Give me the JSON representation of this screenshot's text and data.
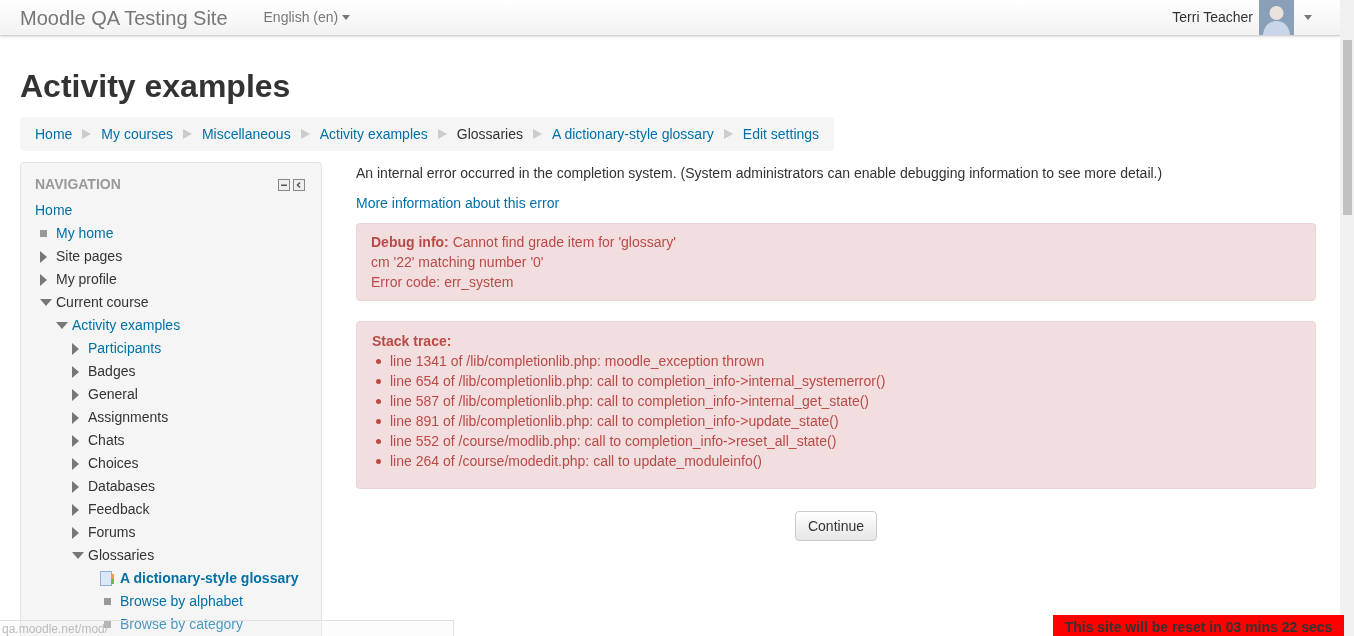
{
  "navbar": {
    "site_name": "Moodle QA Testing Site",
    "language": "English (en)",
    "user_name": "Terri Teacher"
  },
  "page_title": "Activity examples",
  "breadcrumb": [
    {
      "label": "Home",
      "link": true
    },
    {
      "label": "My courses",
      "link": true
    },
    {
      "label": "Miscellaneous",
      "link": true
    },
    {
      "label": "Activity examples",
      "link": true
    },
    {
      "label": "Glossaries",
      "link": false
    },
    {
      "label": "A dictionary-style glossary",
      "link": true
    },
    {
      "label": "Edit settings",
      "link": true
    }
  ],
  "navigation": {
    "title": "NAVIGATION",
    "items": [
      {
        "label": "Home",
        "kind": "root",
        "link": true,
        "current": false
      },
      {
        "label": "My home",
        "kind": "leaf",
        "link": true,
        "current": false
      },
      {
        "label": "Site pages",
        "kind": "branch",
        "expanded": false,
        "link": false,
        "current": false
      },
      {
        "label": "My profile",
        "kind": "branch",
        "expanded": false,
        "link": false,
        "current": false
      },
      {
        "label": "Current course",
        "kind": "branch",
        "expanded": true,
        "link": false,
        "current": false,
        "children": [
          {
            "label": "Activity examples",
            "kind": "branch",
            "expanded": true,
            "link": true,
            "current": false,
            "children": [
              {
                "label": "Participants",
                "kind": "branch",
                "expanded": false,
                "link": true,
                "current": false
              },
              {
                "label": "Badges",
                "kind": "branch",
                "expanded": false,
                "link": false,
                "current": false
              },
              {
                "label": "General",
                "kind": "branch",
                "expanded": false,
                "link": false,
                "current": false
              },
              {
                "label": "Assignments",
                "kind": "branch",
                "expanded": false,
                "link": false,
                "current": false
              },
              {
                "label": "Chats",
                "kind": "branch",
                "expanded": false,
                "link": false,
                "current": false
              },
              {
                "label": "Choices",
                "kind": "branch",
                "expanded": false,
                "link": false,
                "current": false
              },
              {
                "label": "Databases",
                "kind": "branch",
                "expanded": false,
                "link": false,
                "current": false
              },
              {
                "label": "Feedback",
                "kind": "branch",
                "expanded": false,
                "link": false,
                "current": false
              },
              {
                "label": "Forums",
                "kind": "branch",
                "expanded": false,
                "link": false,
                "current": false
              },
              {
                "label": "Glossaries",
                "kind": "branch",
                "expanded": true,
                "link": false,
                "current": false,
                "children": [
                  {
                    "label": "A dictionary-style glossary",
                    "kind": "activity",
                    "link": true,
                    "current": true,
                    "children": [
                      {
                        "label": "Browse by alphabet",
                        "kind": "leaf",
                        "link": true,
                        "current": false
                      },
                      {
                        "label": "Browse by category",
                        "kind": "leaf",
                        "link": true,
                        "current": false
                      }
                    ]
                  }
                ]
              }
            ]
          }
        ]
      }
    ]
  },
  "error": {
    "message": "An internal error occurred in the completion system. (System administrators can enable debugging information to see more detail.)",
    "more_info_link": "More information about this error",
    "debug_lines": [
      "**Debug info:** Cannot find grade item for 'glossary'",
      "cm '22' matching number '0'",
      "Error code: err_system"
    ],
    "stack_title": "Stack trace:",
    "stack_trace": [
      "line 1341 of /lib/completionlib.php: moodle_exception thrown",
      "line 654 of /lib/completionlib.php: call to completion_info->internal_systemerror()",
      "line 587 of /lib/completionlib.php: call to completion_info->internal_get_state()",
      "line 891 of /lib/completionlib.php: call to completion_info->update_state()",
      "line 552 of /course/modlib.php: call to completion_info->reset_all_state()",
      "line 264 of /course/modedit.php: call to update_moduleinfo()"
    ],
    "continue_button": "Continue"
  },
  "status_url": "qa.moodle.net/mod/",
  "reset_banner": "This site will be reset in 03 mins 22 secs"
}
